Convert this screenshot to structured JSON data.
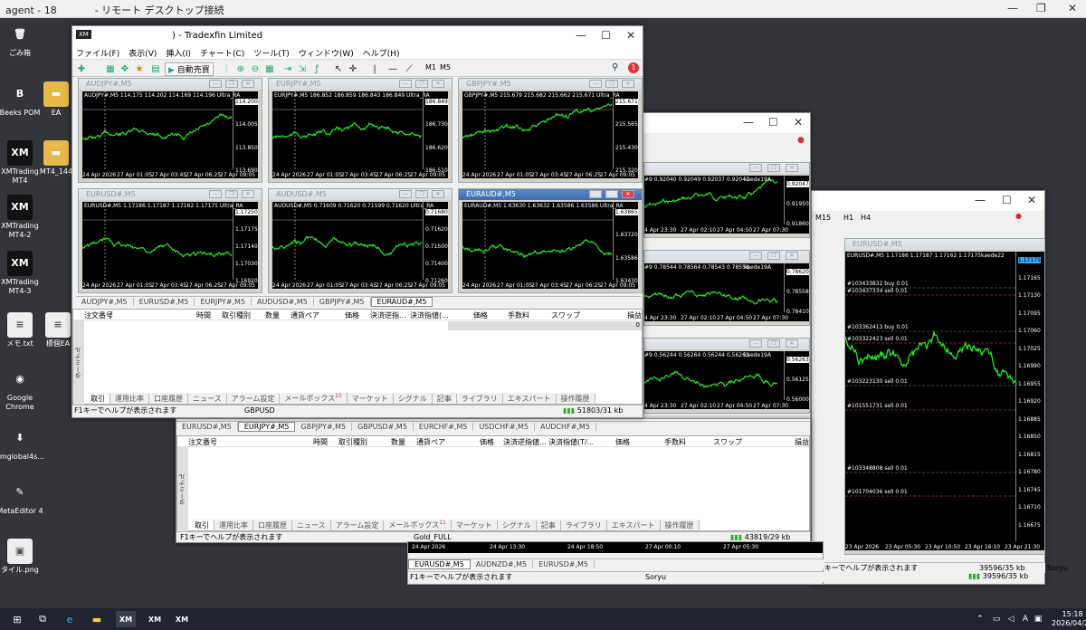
{
  "rdp": {
    "title": "agent - 18",
    "subtitle": "- リモート デスクトップ接続",
    "min": "—",
    "restore": "❐",
    "close": "✕"
  },
  "desktop": {
    "icons": [
      {
        "label": "ごみ箱",
        "glyph": "🗑"
      },
      {
        "label": "Beeks POM",
        "glyph": "B"
      },
      {
        "label": "EA",
        "glyph": "▬"
      },
      {
        "label": "XMTrading MT4",
        "glyph": "XM"
      },
      {
        "label": "MT4_144",
        "glyph": "▬"
      },
      {
        "label": "XMTrading MT4-2",
        "glyph": "XM"
      },
      {
        "label": "XMTrading MT4-3",
        "glyph": "XM"
      },
      {
        "label": "メモ.txt",
        "glyph": "≡"
      },
      {
        "label": "標個EA",
        "glyph": "≡"
      },
      {
        "label": "Google Chrome",
        "glyph": "◉"
      },
      {
        "label": "xmglobal4s...",
        "glyph": "⬇"
      },
      {
        "label": "MetaEditor 4",
        "glyph": "✎"
      },
      {
        "label": "タイル.png",
        "glyph": "▣"
      }
    ]
  },
  "taskbar": {
    "time": "15:18",
    "date": "2026/04/27",
    "lang": "A"
  },
  "win1": {
    "title": ") - Tradexfin Limited",
    "menu": [
      "ファイル(F)",
      "表示(V)",
      "挿入(I)",
      "チャート(C)",
      "ツール(T)",
      "ウィンドウ(W)",
      "ヘルプ(H)"
    ],
    "autotrade": "自動売買",
    "tf1": "M1",
    "tf2": "M5",
    "badge": "1",
    "charts": [
      {
        "title": "AUDJPY#,M5",
        "info": "AUDJPY#,M5  114.175 114.202 114.169 114.196",
        "suffix": "Ultra_RA",
        "prices": [
          "114.200",
          "114.005",
          "113.850",
          "113.690"
        ],
        "times": [
          "24 Apr 2026",
          "27 Apr 01:05",
          "27 Apr 03:45",
          "27 Apr 06:25",
          "27 Apr 09:05"
        ]
      },
      {
        "title": "EURJPY#,M5",
        "info": "EURJPY#,M5  186.852 186.859 186.843 186.849",
        "suffix": "Ultra_RA",
        "prices": [
          "186.849",
          "186.730",
          "186.620",
          "186.510"
        ],
        "times": [
          "24 Apr 2026",
          "27 Apr 01:05",
          "27 Apr 03:45",
          "27 Apr 06:25",
          "27 Apr 09:05"
        ]
      },
      {
        "title": "GBPJPY#,M5",
        "info": "GBPJPY#,M5  215.679 215.682 215.662 215.671",
        "suffix": "Ultra_RA",
        "prices": [
          "215.671",
          "215.565",
          "215.430",
          "215.320"
        ],
        "times": [
          "24 Apr 2026",
          "27 Apr 01:05",
          "27 Apr 03:45",
          "27 Apr 06:25",
          "27 Apr 09:05"
        ]
      },
      {
        "title": "EURUSD#,M5",
        "info": "EURUSD#,M5  1.17186 1.17187 1.17162 1.17175",
        "suffix": "Ultra_RA",
        "prices": [
          "1.17250",
          "1.17175",
          "1.17140",
          "1.17030",
          "1.16920"
        ],
        "times": [
          "24 Apr 2026",
          "27 Apr 01:05",
          "27 Apr 03:45",
          "27 Apr 06:25",
          "27 Apr 09:05"
        ]
      },
      {
        "title": "AUDUSD#,M5",
        "info": "AUDUSD#,M5  0.71609 0.71620 0.71599 0.71620",
        "suffix": "Ultra_RA",
        "prices": [
          "0.71680",
          "0.71620",
          "0.71500",
          "0.71400",
          "0.71260"
        ],
        "times": [
          "24 Apr 2026",
          "27 Apr 01:05",
          "27 Apr 03:45",
          "27 Apr 06:25",
          "27 Apr 09:05"
        ]
      },
      {
        "title": "EURAUD#,M5",
        "info": "EURAUD#,M5  1.63630 1.63632 1.63586 1.63586",
        "suffix": "Ultra_RA",
        "prices": [
          "1.63865",
          "1.63720",
          "1.63586",
          "1.63430"
        ],
        "times": [
          "24 Apr 2026",
          "27 Apr 01:05",
          "27 Apr 03:45",
          "27 Apr 06:25",
          "27 Apr 09:05"
        ]
      }
    ],
    "chart_tabs": [
      "AUDJPY#,M5",
      "EURUSD#,M5",
      "EURJPY#,M5",
      "AUDUSD#,M5",
      "GBPJPY#,M5",
      "EURAUD#,M5"
    ],
    "term_cols": [
      "注文番号",
      "/",
      "時間",
      "取引種別",
      "数量",
      "通貨ペア",
      "価格",
      "決済逆指...",
      "決済指値(...",
      "価格",
      "手数料",
      "スワップ",
      "損益"
    ],
    "term_value": "0",
    "term_tabs": [
      "取引",
      "運用比率",
      "口座履歴",
      "ニュース",
      "アラーム設定",
      "メールボックス",
      "マーケット",
      "シグナル",
      "記事",
      "ライブラリ",
      "エキスパート",
      "操作履歴"
    ],
    "mail_count": "15",
    "term_side": "ターミナル",
    "status_help": "F1キーでヘルプが表示されます",
    "status_sym": "GBPUSD",
    "status_kb": "51803/31 kb"
  },
  "win2": {
    "charts": [
      {
        "info": "#9  0.92040 0.92049 0.92037 0.92047",
        "user": "kaede19A",
        "prices": [
          "0.92047",
          "0.91950",
          "0.91860"
        ],
        "times": [
          "4 Apr 23:30",
          "27 Apr 02:10",
          "27 Apr 04:50",
          "27 Apr 07:30"
        ]
      },
      {
        "info": "#9  0.78544 0.78564 0.78543 0.78558",
        "user": "kaede19A",
        "prices": [
          "0.78620",
          "0.78558",
          "0.78410"
        ],
        "times": [
          "4 Apr 23:30",
          "27 Apr 02:10",
          "27 Apr 04:50",
          "27 Apr 07:30"
        ]
      },
      {
        "info": "#9  0.56244 0.56264 0.56244 0.56263",
        "user": "kaede19A",
        "prices": [
          "0.56263",
          "0.56125",
          "0.56000"
        ],
        "times": [
          "4 Apr 23:30",
          "27 Apr 02:10",
          "27 Apr 04:50",
          "27 Apr 07:30"
        ]
      }
    ],
    "tabs": [
      "EURUSD#,M5",
      "EURJPY#,M5",
      "GBPJPY#,M5",
      "GBPUSD#,M5",
      "EURCHF#,M5",
      "USDCHF#,M5",
      "AUDCHF#,M5"
    ],
    "term_cols": [
      "注文番号",
      "時間",
      "取引種別",
      "数量",
      "通貨ペア",
      "価格",
      "決済逆指値...",
      "決済指値(T/...",
      "価格",
      "手数料",
      "スワップ",
      "損益"
    ],
    "term_tabs": [
      "取引",
      "運用比率",
      "口座履歴",
      "ニュース",
      "アラーム設定",
      "メールボックス",
      "マーケット",
      "シグナル",
      "記事",
      "ライブラリ",
      "エキスパート",
      "操作履歴"
    ],
    "mail_count": "11",
    "term_side": "ターミナル",
    "status_help": "F1キーでヘルプが表示されます",
    "status_sym": "Gold_FULL",
    "status_kb": "43819/29 kb",
    "bottom_times": [
      "24 Apr 2026",
      "24 Apr 13:30",
      "24 Apr 18:50",
      "27 Apr 00:10",
      "27 Apr 05:30"
    ],
    "side_prices": [
      "744",
      "495",
      "415",
      "335",
      "255",
      "175",
      "095",
      "015"
    ]
  },
  "win3": {
    "tf": [
      "M15",
      "H1",
      "H4"
    ],
    "chart_title": "EURUSD#,M5",
    "info": "EURUSD#,M5  1.17186 1.17187 1.17162 1.17175",
    "user": "kaede22",
    "prices": [
      "1.17175",
      "1.17165",
      "1.17130",
      "1.17095",
      "1.17060",
      "1.17025",
      "1.16990",
      "1.16955",
      "1.16920",
      "1.16885",
      "1.16850",
      "1.16815",
      "1.16780",
      "1.16745",
      "1.16710",
      "1.16675"
    ],
    "orders": [
      "#103433832 buy 0.01",
      "#103437334 sell 0.01",
      "#103362413 buy 0.01",
      "#103322423 sell 0.01",
      "#103223130 sell 0.01",
      "#101551731 sell 0.01",
      "#103348808 sell 0.01",
      "#101704036 sell 0.01"
    ],
    "times": [
      "23 Apr 2026",
      "23 Apr 05:30",
      "23 Apr 10:50",
      "23 Apr 16:10",
      "23 Apr 21:30"
    ],
    "btimes": [
      "24 Apr 2026",
      "24 Apr 13:30",
      "24 Apr 18:50",
      "27 Apr 00:10",
      "27 Apr 05:30"
    ],
    "tabs": [
      "EURUSD#,M5",
      "AUDNZD#,M5",
      "EURUSD#,M5"
    ],
    "status_help": "F1キーでヘルプが表示されます",
    "status_sym": "Soryu",
    "status_kb": "39596/35 kb"
  }
}
